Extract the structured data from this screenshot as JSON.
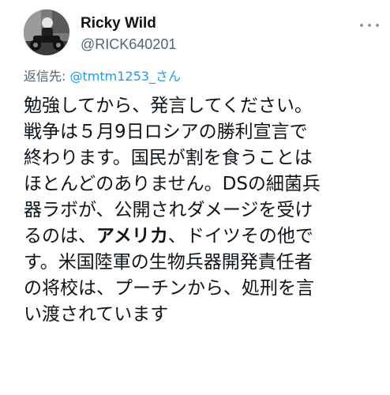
{
  "tweet": {
    "author": {
      "display_name": "Ricky Wild",
      "handle": "@RICK640201",
      "avatar_icon": "motorcycle-rider-avatar"
    },
    "more_icon": "more-dots-icon",
    "reply": {
      "prefix": "返信先:",
      "target": "@tmtm1253_さん"
    },
    "body_lines": [
      "勉強してから、発言してください。",
      "戦争は５月9日ロシアの勝利宣言で",
      "終わります。国民が割を食うことは",
      "ほとんどのありません。DSの細菌兵",
      "器ラボが、公開されダメージを受け",
      {
        "pre": "るのは、",
        "bold": "アメリカ",
        "post": "、ドイツその他で"
      },
      "す。米国陸軍の生物兵器開発責任者",
      "の将校は、プーチンから、処刑を言",
      "い渡されています"
    ],
    "colors": {
      "link": "#1d9bf0",
      "secondary": "#536471",
      "text": "#0f1419"
    }
  }
}
